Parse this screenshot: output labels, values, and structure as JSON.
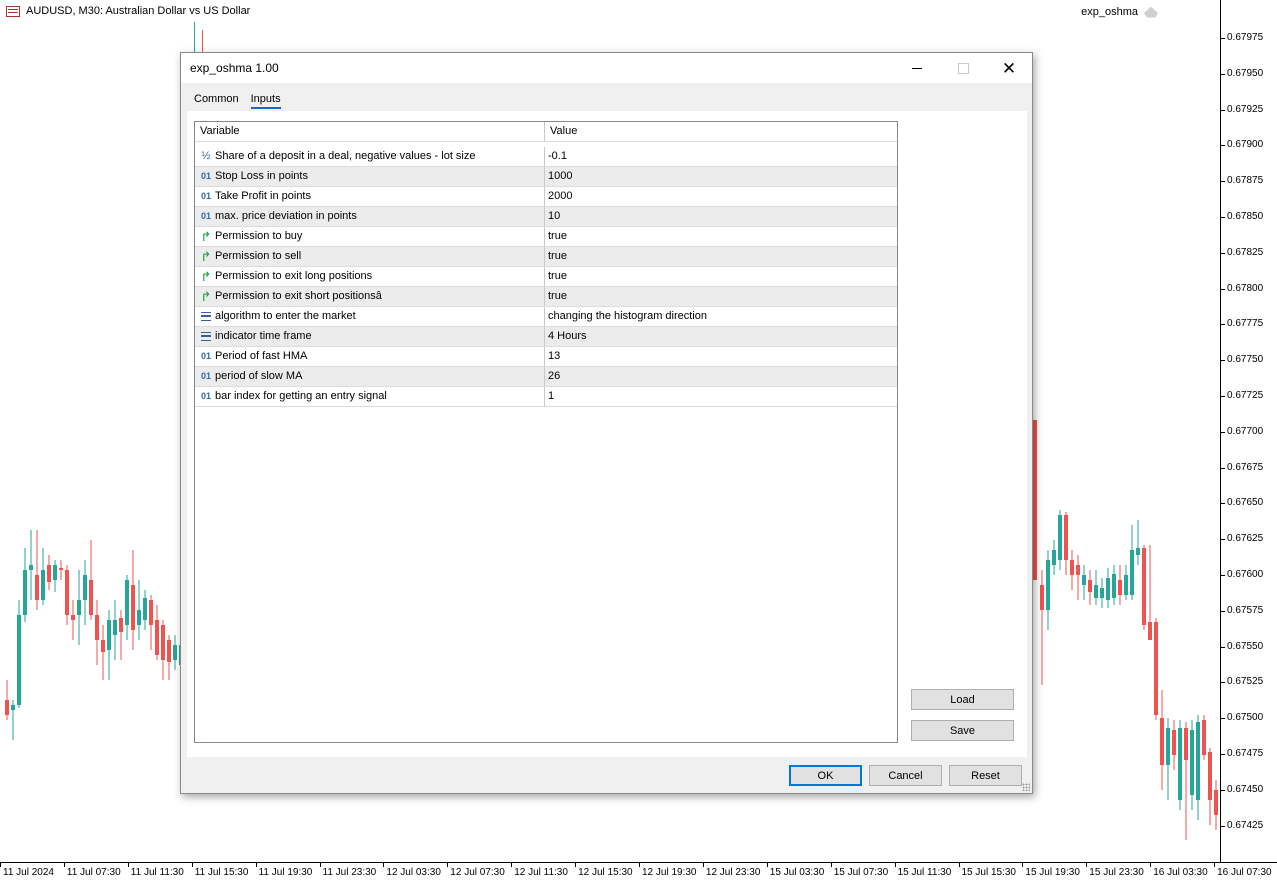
{
  "chart": {
    "symbol_title": "AUDUSD, M30:  Australian Dollar vs US Dollar",
    "expert_label": "exp_oshma",
    "price_ticks": [
      "0.67975",
      "0.67950",
      "0.67925",
      "0.67900",
      "0.67875",
      "0.67850",
      "0.67825",
      "0.67800",
      "0.67775",
      "0.67750",
      "0.67725",
      "0.67700",
      "0.67675",
      "0.67650",
      "0.67625",
      "0.67600",
      "0.67575",
      "0.67550",
      "0.67525",
      "0.67500",
      "0.67475",
      "0.67450",
      "0.67425"
    ],
    "time_ticks": [
      "11 Jul 2024",
      "11 Jul 07:30",
      "11 Jul 11:30",
      "11 Jul 15:30",
      "11 Jul 19:30",
      "11 Jul 23:30",
      "12 Jul 03:30",
      "12 Jul 07:30",
      "12 Jul 11:30",
      "12 Jul 15:30",
      "12 Jul 19:30",
      "12 Jul 23:30",
      "15 Jul 03:30",
      "15 Jul 07:30",
      "15 Jul 11:30",
      "15 Jul 15:30",
      "15 Jul 19:30",
      "15 Jul 23:30",
      "16 Jul 03:30",
      "16 Jul 07:30"
    ],
    "colors": {
      "bull": "#26a69a",
      "bear": "#ef5350"
    }
  },
  "dialog": {
    "title": "exp_oshma 1.00",
    "tabs": [
      {
        "label": "Common"
      },
      {
        "label": "Inputs"
      }
    ],
    "active_tab": "Inputs",
    "table": {
      "headers": {
        "variable": "Variable",
        "value": "Value"
      },
      "rows": [
        {
          "icon": "fraction-icon",
          "variable": "Share of a deposit in a deal, negative values - lot size",
          "value": "-0.1"
        },
        {
          "icon": "integer-icon",
          "variable": "Stop Loss in points",
          "value": "1000"
        },
        {
          "icon": "integer-icon",
          "variable": "Take Profit in points",
          "value": "2000"
        },
        {
          "icon": "integer-icon",
          "variable": "max. price deviation in points",
          "value": "10"
        },
        {
          "icon": "bool-arrow-icon",
          "variable": "Permission to buy",
          "value": "true"
        },
        {
          "icon": "bool-arrow-icon",
          "variable": "Permission to sell",
          "value": "true"
        },
        {
          "icon": "bool-arrow-icon",
          "variable": "Permission to exit long positions",
          "value": "true"
        },
        {
          "icon": "bool-arrow-icon",
          "variable": "Permission to exit short positionsâ",
          "value": "true"
        },
        {
          "icon": "enum-icon",
          "variable": "algorithm to enter the market",
          "value": "changing the histogram direction"
        },
        {
          "icon": "enum-icon",
          "variable": "indicator time frame",
          "value": "4 Hours"
        },
        {
          "icon": "integer-icon",
          "variable": "Period of fast HMA",
          "value": "13"
        },
        {
          "icon": "integer-icon",
          "variable": "period of slow MA",
          "value": "26"
        },
        {
          "icon": "integer-icon",
          "variable": "bar index for getting an entry signal",
          "value": "1"
        }
      ]
    },
    "buttons": {
      "load": "Load",
      "save": "Save",
      "ok": "OK",
      "cancel": "Cancel",
      "reset": "Reset"
    }
  }
}
